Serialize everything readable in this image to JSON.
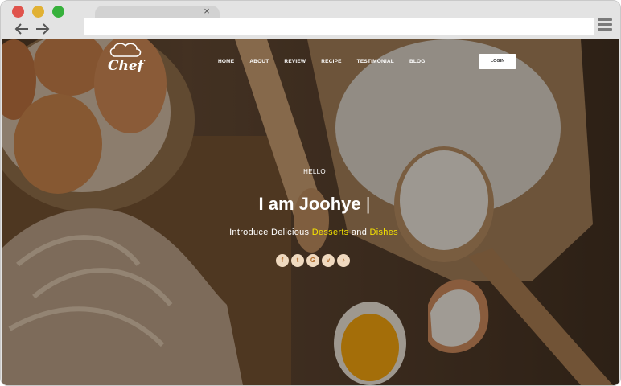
{
  "browser": {
    "tab_close_glyph": "×",
    "back_glyph": "←",
    "forward_glyph": "→",
    "url": ""
  },
  "site": {
    "logo_text": "Chef",
    "nav": [
      {
        "label": "HOME",
        "active": true
      },
      {
        "label": "ABOUT"
      },
      {
        "label": "REVIEW"
      },
      {
        "label": "RECIPE"
      },
      {
        "label": "TESTIMONIAL"
      },
      {
        "label": "BLOG"
      }
    ],
    "login_label": "LOGIN"
  },
  "hero": {
    "greeting": "HELLO",
    "headline": "I am Joohye",
    "cursor": "|",
    "sub_prefix": "Introduce Delicious",
    "sub_hl1": "Desserts",
    "sub_mid": "and",
    "sub_hl2": "Dishes",
    "highlight_color": "#f5e300"
  },
  "socials": [
    {
      "icon": "facebook-icon",
      "glyph": "f"
    },
    {
      "icon": "twitter-icon",
      "glyph": "t"
    },
    {
      "icon": "google-plus-icon",
      "glyph": "G"
    },
    {
      "icon": "vimeo-icon",
      "glyph": "v"
    },
    {
      "icon": "tiktok-icon",
      "glyph": "♪"
    }
  ]
}
